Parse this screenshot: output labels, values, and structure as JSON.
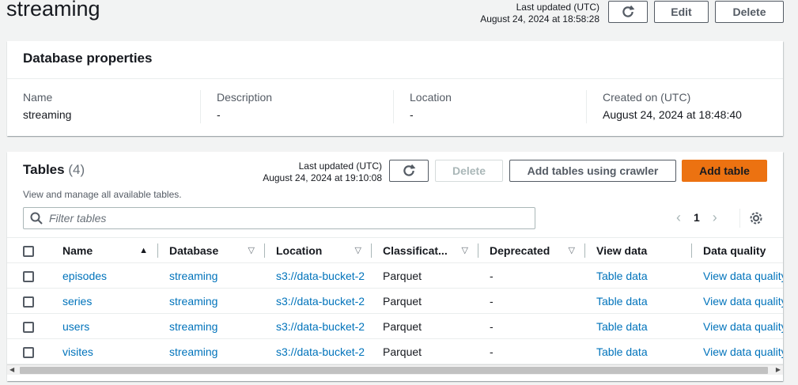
{
  "page": {
    "title": "streaming",
    "last_updated_label": "Last updated (UTC)",
    "last_updated_value": "August 24, 2024 at 18:58:28",
    "edit_label": "Edit",
    "delete_label": "Delete"
  },
  "properties": {
    "header": "Database properties",
    "fields": [
      {
        "label": "Name",
        "value": "streaming"
      },
      {
        "label": "Description",
        "value": "-"
      },
      {
        "label": "Location",
        "value": "-"
      },
      {
        "label": "Created on (UTC)",
        "value": "August 24, 2024 at 18:48:40"
      }
    ]
  },
  "tables": {
    "title": "Tables",
    "count": "(4)",
    "description": "View and manage all available tables.",
    "last_updated_label": "Last updated (UTC)",
    "last_updated_value": "August 24, 2024 at 19:10:08",
    "delete_label": "Delete",
    "crawler_label": "Add tables using crawler",
    "add_label": "Add table",
    "filter_placeholder": "Filter tables",
    "page_number": "1",
    "columns": [
      "Name",
      "Database",
      "Location",
      "Classificat...",
      "Deprecated",
      "View data",
      "Data quality"
    ],
    "rows": [
      {
        "name": "episodes",
        "database": "streaming",
        "location": "s3://data-bucket-2",
        "classification": "Parquet",
        "deprecated": "-",
        "view": "Table data",
        "quality": "View data quality"
      },
      {
        "name": "series",
        "database": "streaming",
        "location": "s3://data-bucket-2",
        "classification": "Parquet",
        "deprecated": "-",
        "view": "Table data",
        "quality": "View data quality"
      },
      {
        "name": "users",
        "database": "streaming",
        "location": "s3://data-bucket-2",
        "classification": "Parquet",
        "deprecated": "-",
        "view": "Table data",
        "quality": "View data quality"
      },
      {
        "name": "visites",
        "database": "streaming",
        "location": "s3://data-bucket-2",
        "classification": "Parquet",
        "deprecated": "-",
        "view": "Table data",
        "quality": "View data quality"
      }
    ]
  },
  "icons": {
    "refresh": "refresh-icon",
    "search": "search-icon",
    "settings": "gear-icon"
  },
  "colors": {
    "accent": "#ec7211",
    "link": "#0073bb",
    "background": "#f2f3f3"
  }
}
